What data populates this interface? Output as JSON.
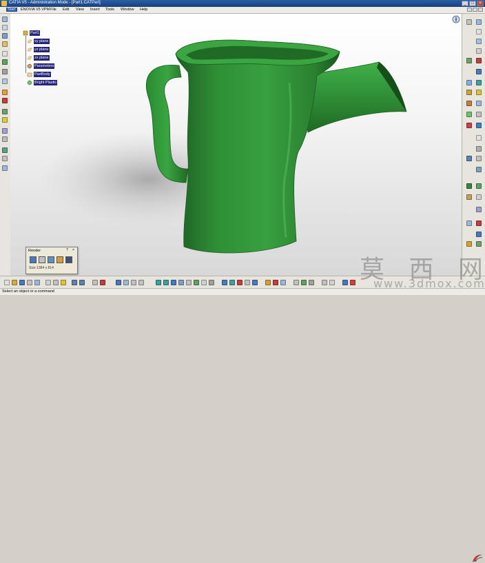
{
  "titlebar": {
    "title": "CATIA V5 - Administration Mode - [Part1.CATPart]"
  },
  "menu": {
    "start": "Start",
    "items": [
      "ENOVIA V5 VPM",
      "File",
      "Edit",
      "View",
      "Insert",
      "Tools",
      "Window",
      "Help"
    ]
  },
  "tree": {
    "root": "Part1",
    "planes": [
      "xy plane",
      "yz plane",
      "zx plane"
    ],
    "parameters": "Parameters",
    "partbody": "PartBody",
    "material": "Bright Plastic"
  },
  "render_panel": {
    "title": "Render",
    "size_label": "Size 1384 x 814"
  },
  "statusbar": {
    "text": "Select an object or a command"
  },
  "watermark": {
    "chinese": "莫 西 网",
    "url": "www.3dmox.com"
  },
  "colors": {
    "jug_green": "#2e8a35",
    "jug_dark": "#1b5e22",
    "tree_highlight": "#24247a",
    "title_blue": "#2a5fa8"
  },
  "icons": {
    "compass": "compass-icon",
    "catia_logo": "catia-logo-icon"
  }
}
